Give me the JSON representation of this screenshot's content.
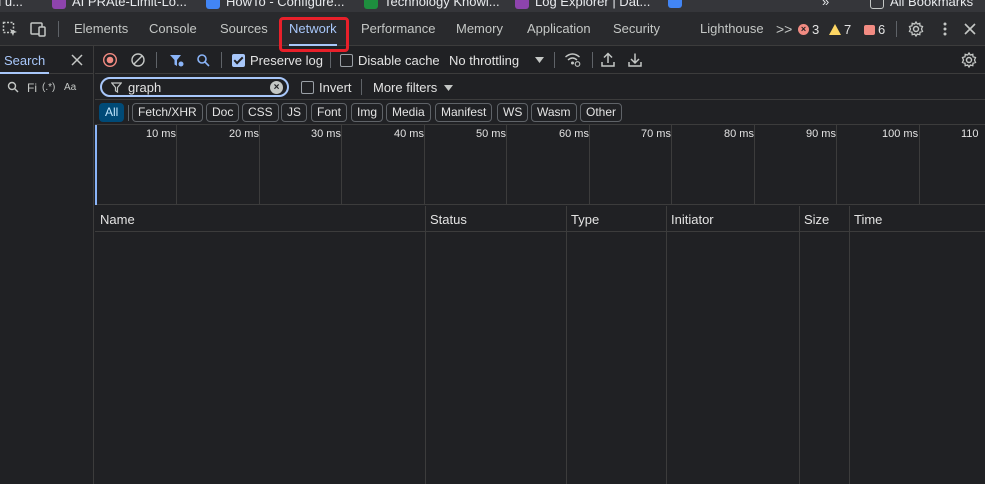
{
  "bookmarks": {
    "items": [
      {
        "label": "d u...",
        "color": "#e8eaed"
      },
      {
        "label": "AI PRAte-Limit-Lo...",
        "color": "#8e44ad"
      },
      {
        "label": "HowTo - Configure...",
        "color": "#4285f4"
      },
      {
        "label": "Technology Knowl...",
        "color": "#1e8e3e"
      },
      {
        "label": "Log Explorer | Dat...",
        "color": "#8e44ad"
      }
    ],
    "more": "»",
    "all_bookmarks": "All Bookmarks"
  },
  "tabs": {
    "items": [
      "Elements",
      "Console",
      "Sources",
      "Network",
      "Performance",
      "Memory",
      "Application",
      "Security",
      "Lighthouse"
    ],
    "active": "Network",
    "overflow": ">>",
    "errors": "3",
    "warnings": "7",
    "issues": "6"
  },
  "drawer": {
    "title": "Search",
    "find_placeholder": "Fi",
    "regex": "(.*)",
    "case": "Aa"
  },
  "toolbar": {
    "preserve_log": "Preserve log",
    "preserve_log_checked": true,
    "disable_cache": "Disable cache",
    "disable_cache_checked": false,
    "throttling": "No throttling"
  },
  "filter": {
    "value": "graph",
    "invert": "Invert",
    "more_filters": "More filters"
  },
  "type_filters": [
    "All",
    "Fetch/XHR",
    "Doc",
    "CSS",
    "JS",
    "Font",
    "Img",
    "Media",
    "Manifest",
    "WS",
    "Wasm",
    "Other"
  ],
  "active_type": "All",
  "timeline": {
    "ticks": [
      "10 ms",
      "20 ms",
      "30 ms",
      "40 ms",
      "50 ms",
      "60 ms",
      "70 ms",
      "80 ms",
      "90 ms",
      "100 ms",
      "110"
    ]
  },
  "table": {
    "columns": [
      "Name",
      "Status",
      "Type",
      "Initiator",
      "Size",
      "Time"
    ],
    "rows": []
  },
  "colors": {
    "accent": "#a8c7fa",
    "highlight_box": "#e8202a",
    "error": "#f28b82",
    "warning": "#fdd663"
  }
}
